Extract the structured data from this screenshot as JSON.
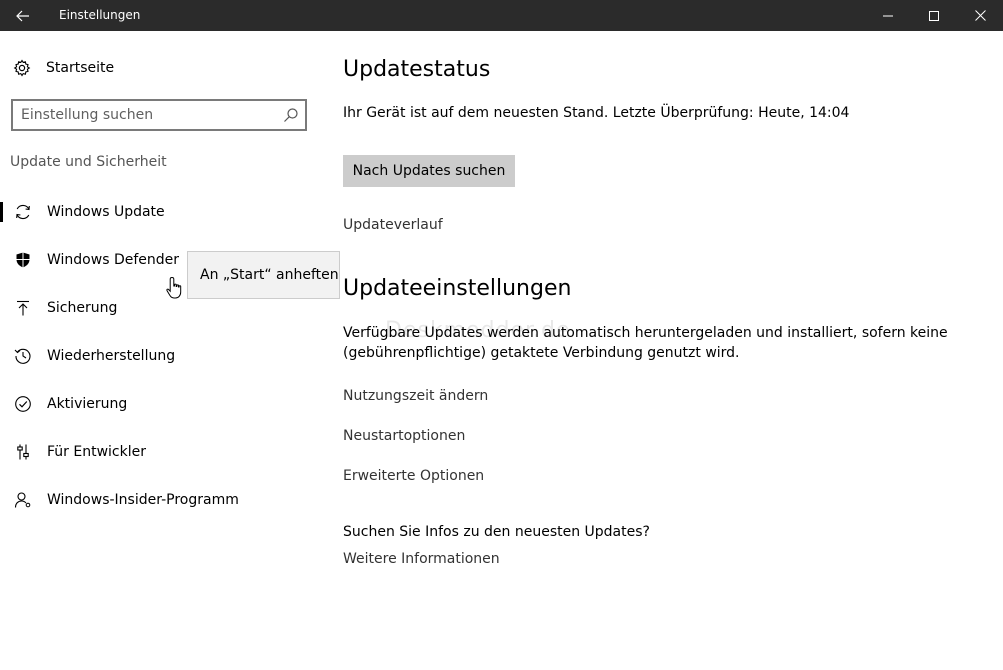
{
  "window": {
    "title": "Einstellungen",
    "back_icon": "arrow-left-icon",
    "minimize_icon": "minimize-icon",
    "maximize_icon": "maximize-icon",
    "close_icon": "close-icon"
  },
  "sidebar": {
    "home_label": "Startseite",
    "search_placeholder": "Einstellung suchen",
    "section_label": "Update und Sicherheit",
    "items": [
      {
        "label": "Windows Update",
        "icon": "refresh-icon",
        "selected": true
      },
      {
        "label": "Windows Defender",
        "icon": "shield-icon",
        "selected": false
      },
      {
        "label": "Sicherung",
        "icon": "upload-arrow-icon",
        "selected": false
      },
      {
        "label": "Wiederherstellung",
        "icon": "history-icon",
        "selected": false
      },
      {
        "label": "Aktivierung",
        "icon": "check-circle-icon",
        "selected": false
      },
      {
        "label": "Für Entwickler",
        "icon": "sliders-icon",
        "selected": false
      },
      {
        "label": "Windows-Insider-Programm",
        "icon": "person-icon",
        "selected": false
      }
    ],
    "tooltip": "An „Start“ anheften"
  },
  "main": {
    "update_status": {
      "heading": "Updatestatus",
      "status_text": "Ihr Gerät ist auf dem neuesten Stand. Letzte Überprüfung: Heute, 14:04",
      "check_button": "Nach Updates suchen",
      "history_link": "Updateverlauf"
    },
    "update_settings": {
      "heading": "Updateeinstellungen",
      "description_line1": "Verfügbare Updates werden automatisch heruntergeladen und installiert, sofern keine",
      "description_line2": "(gebührenpflichtige) getaktete Verbindung genutzt wird.",
      "links": [
        "Nutzungszeit ändern",
        "Neustartoptionen",
        "Erweiterte Optionen"
      ]
    },
    "info": {
      "question": "Suchen Sie Infos zu den neuesten Updates?",
      "link": "Weitere Informationen"
    }
  },
  "watermark": "Deskmodder.de",
  "colors": {
    "titlebar": "#2b2b2b",
    "button": "#cccccc",
    "selection_bar": "#000000"
  }
}
